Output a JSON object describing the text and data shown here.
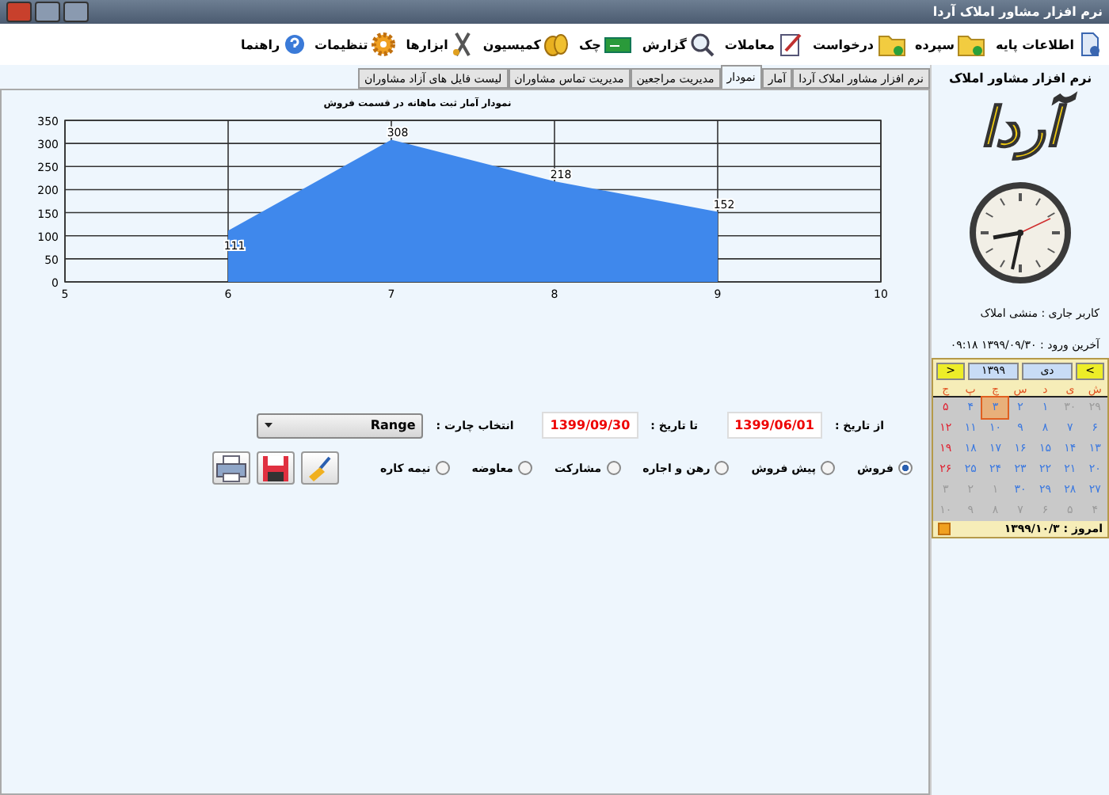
{
  "window": {
    "title": "نرم افزار مشاور املاک آردا"
  },
  "toolbar": [
    {
      "label": "اطلاعات پایه",
      "kind": "page"
    },
    {
      "label": "سپرده",
      "kind": "folder"
    },
    {
      "label": "درخواست",
      "kind": "folder"
    },
    {
      "label": "معاملات",
      "kind": "pen"
    },
    {
      "label": "گزارش",
      "kind": "search"
    },
    {
      "label": "چک",
      "kind": "cheque"
    },
    {
      "label": "کمیسیون",
      "kind": "coins"
    },
    {
      "label": "ابزارها",
      "kind": "tools"
    },
    {
      "label": "تنظیمات",
      "kind": "gear"
    },
    {
      "label": "راهنما",
      "kind": "help"
    }
  ],
  "tabs": [
    {
      "label": "نرم افزار مشاور املاک آردا",
      "selected": false
    },
    {
      "label": "آمار",
      "selected": false
    },
    {
      "label": "نمودار",
      "selected": true
    },
    {
      "label": "مدیریت مراجعین",
      "selected": false
    },
    {
      "label": "مدیریت تماس مشاوران",
      "selected": false
    },
    {
      "label": "لیست فایل های آزاد مشاوران",
      "selected": false
    }
  ],
  "chart": {
    "chart_data": {
      "type": "area",
      "title": "نمودار آمار ثبت ماهانه در قسمت فروش",
      "x": [
        6,
        7,
        8,
        9
      ],
      "series": [
        {
          "color": "#3f88ec",
          "values": [
            111,
            308,
            218,
            152
          ]
        }
      ],
      "grid": true,
      "xlim": [
        5,
        10
      ],
      "ylim": [
        0,
        350
      ],
      "xticks": [
        5,
        6,
        7,
        8,
        9,
        10
      ],
      "yticks": [
        0,
        50,
        100,
        150,
        200,
        250,
        300,
        350
      ],
      "data_labels": true
    }
  },
  "filter": {
    "from_label": "از تاریخ :",
    "from_value": "1399/06/01",
    "to_label": "تا تاریخ :",
    "to_value": "1399/09/30",
    "chart_label": "انتخاب چارت :",
    "chart_value": "Range"
  },
  "radios": [
    {
      "label": "فروش",
      "selected": true
    },
    {
      "label": "پیش فروش",
      "selected": false
    },
    {
      "label": "رهن و اجاره",
      "selected": false
    },
    {
      "label": "مشارکت",
      "selected": false
    },
    {
      "label": "معاوضه",
      "selected": false
    },
    {
      "label": "نیمه کاره",
      "selected": false
    }
  ],
  "actions": [
    {
      "kind": "clear"
    },
    {
      "kind": "save"
    },
    {
      "kind": "print"
    }
  ],
  "sidebar": {
    "heading": "نرم افزار مشاور املاک",
    "logo": "آردا",
    "current_user": "کاربر جاری : منشی املاک",
    "last_login": "آخرین ورود : ۱۳۹۹/۰۹/۳۰ ۰۹:۱۸"
  },
  "calendar": {
    "prev": "<",
    "year": "۱۳۹۹",
    "month": "دی",
    "next": ">",
    "weekdays": [
      "ش",
      "ی",
      "د",
      "س",
      "چ",
      "پ",
      "ج"
    ],
    "weeks": [
      [
        {
          "day": "۲۹",
          "kind": "other",
          "selected": false
        },
        {
          "day": "۳۰",
          "kind": "other",
          "selected": false
        },
        {
          "day": "۱",
          "kind": "day",
          "selected": false
        },
        {
          "day": "۲",
          "kind": "day",
          "selected": false
        },
        {
          "day": "۳",
          "kind": "day",
          "selected": true
        },
        {
          "day": "۴",
          "kind": "day",
          "selected": false
        },
        {
          "day": "۵",
          "kind": "holiday",
          "selected": false
        }
      ],
      [
        {
          "day": "۶",
          "kind": "day",
          "selected": false
        },
        {
          "day": "۷",
          "kind": "day",
          "selected": false
        },
        {
          "day": "۸",
          "kind": "day",
          "selected": false
        },
        {
          "day": "۹",
          "kind": "day",
          "selected": false
        },
        {
          "day": "۱۰",
          "kind": "day",
          "selected": false
        },
        {
          "day": "۱۱",
          "kind": "day",
          "selected": false
        },
        {
          "day": "۱۲",
          "kind": "holiday",
          "selected": false
        }
      ],
      [
        {
          "day": "۱۳",
          "kind": "day",
          "selected": false
        },
        {
          "day": "۱۴",
          "kind": "day",
          "selected": false
        },
        {
          "day": "۱۵",
          "kind": "day",
          "selected": false
        },
        {
          "day": "۱۶",
          "kind": "day",
          "selected": false
        },
        {
          "day": "۱۷",
          "kind": "day",
          "selected": false
        },
        {
          "day": "۱۸",
          "kind": "day",
          "selected": false
        },
        {
          "day": "۱۹",
          "kind": "holiday",
          "selected": false
        }
      ],
      [
        {
          "day": "۲۰",
          "kind": "day",
          "selected": false
        },
        {
          "day": "۲۱",
          "kind": "day",
          "selected": false
        },
        {
          "day": "۲۲",
          "kind": "day",
          "selected": false
        },
        {
          "day": "۲۳",
          "kind": "day",
          "selected": false
        },
        {
          "day": "۲۴",
          "kind": "day",
          "selected": false
        },
        {
          "day": "۲۵",
          "kind": "day",
          "selected": false
        },
        {
          "day": "۲۶",
          "kind": "holiday",
          "selected": false
        }
      ],
      [
        {
          "day": "۲۷",
          "kind": "day",
          "selected": false
        },
        {
          "day": "۲۸",
          "kind": "day",
          "selected": false
        },
        {
          "day": "۲۹",
          "kind": "day",
          "selected": false
        },
        {
          "day": "۳۰",
          "kind": "day",
          "selected": false
        },
        {
          "day": "۱",
          "kind": "other",
          "selected": false
        },
        {
          "day": "۲",
          "kind": "other",
          "selected": false
        },
        {
          "day": "۳",
          "kind": "other",
          "selected": false
        }
      ],
      [
        {
          "day": "۴",
          "kind": "other",
          "selected": false
        },
        {
          "day": "۵",
          "kind": "other",
          "selected": false
        },
        {
          "day": "۶",
          "kind": "other",
          "selected": false
        },
        {
          "day": "۷",
          "kind": "other",
          "selected": false
        },
        {
          "day": "۸",
          "kind": "other",
          "selected": false
        },
        {
          "day": "۹",
          "kind": "other",
          "selected": false
        },
        {
          "day": "۱۰",
          "kind": "other",
          "selected": false
        }
      ]
    ],
    "today": "امروز : ۱۳۹۹/۱۰/۳"
  }
}
